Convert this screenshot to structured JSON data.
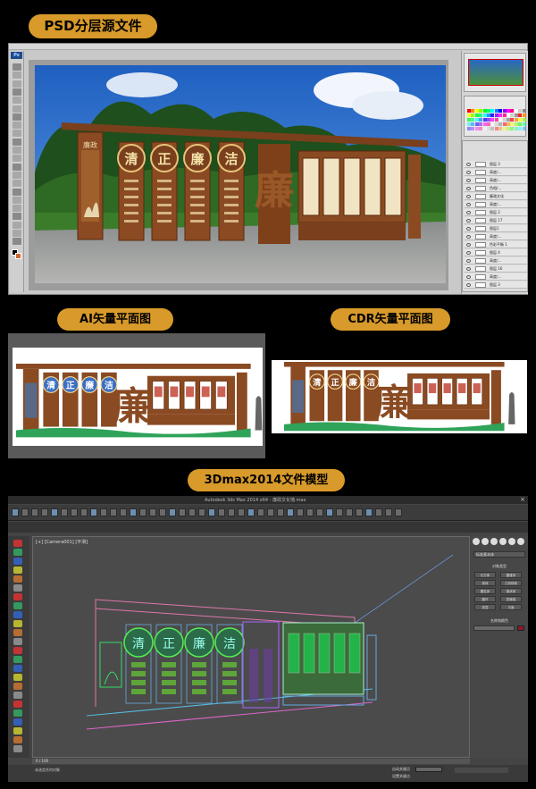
{
  "sections": {
    "psd_title": "PSD分层源文件",
    "ai_title": "AI矢量平面图",
    "cdr_title": "CDR矢量平面图",
    "max_title": "3Dmax2014文件模型"
  },
  "psd": {
    "app_badge": "Ps",
    "signboard_circles": [
      "清",
      "正",
      "廉",
      "洁"
    ],
    "signboard_big_char": "廉",
    "left_panel_text": "廉政",
    "layers": [
      "图层 3",
      "高度/...",
      "高度/...",
      "色相/...",
      "廉政文化",
      "高度/...",
      "图层 2",
      "图层 17",
      "图层1",
      "高度/...",
      "色彩平衡 1",
      "图层 4",
      "高度/...",
      "图层 16",
      "高度/...",
      "图层 3"
    ]
  },
  "ai": {
    "circles": [
      "清",
      "正",
      "廉",
      "洁"
    ],
    "big_char": "廉"
  },
  "cdr": {
    "circles": [
      "清",
      "正",
      "廉",
      "洁"
    ],
    "big_char": "廉"
  },
  "max": {
    "window_title": "Autodesk 3ds Max 2014 x64 - 廉政文化墙.max",
    "viewport_label": "[+] [Camera001] [平滑]",
    "circles": [
      "清",
      "正",
      "廉",
      "洁"
    ],
    "cmd_category": "标准基本体",
    "cmd_section_title": "对象类型",
    "cmd_buttons": [
      "长方体",
      "圆锥体",
      "球体",
      "几何球体",
      "圆柱体",
      "管状体",
      "圆环",
      "四棱锥",
      "茶壶",
      "平面"
    ],
    "name_color_title": "名称和颜色",
    "status_left": "未选定任何对象",
    "timeline_range": "0 / 100",
    "auto_key": "自动关键点",
    "set_key": "设置关键点"
  },
  "colors": {
    "banner": "#d89a2a",
    "wood": "#8a4a22",
    "max_bg": "#444444"
  }
}
